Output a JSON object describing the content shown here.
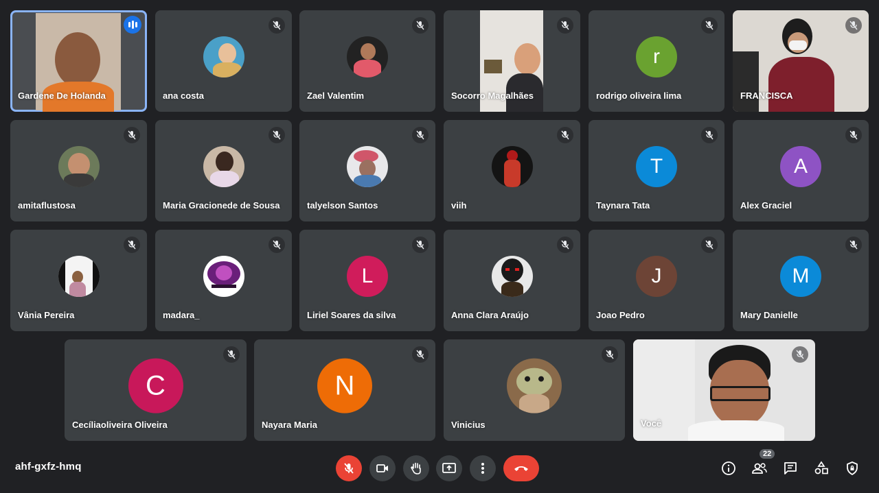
{
  "meeting": {
    "code": "ahf-gxfz-hmq",
    "participants_count": "22"
  },
  "participants": [
    {
      "name": "Gardene De Holanda",
      "kind": "video",
      "speaking": true
    },
    {
      "name": "ana costa",
      "kind": "photo"
    },
    {
      "name": "Zael Valentim",
      "kind": "photo"
    },
    {
      "name": "Socorro Magalhães",
      "kind": "video"
    },
    {
      "name": "rodrigo oliveira lima",
      "kind": "initial",
      "initial": "r",
      "color": "#6aa230"
    },
    {
      "name": "FRANCISCA",
      "kind": "video"
    },
    {
      "name": "amitaflustosa",
      "kind": "photo"
    },
    {
      "name": "Maria Gracionede de Sousa",
      "kind": "photo"
    },
    {
      "name": "talyelson Santos",
      "kind": "photo"
    },
    {
      "name": "viih",
      "kind": "photo"
    },
    {
      "name": "Taynara Tata",
      "kind": "initial",
      "initial": "T",
      "color": "#0b8ad8"
    },
    {
      "name": "Alex Graciel",
      "kind": "initial",
      "initial": "A",
      "color": "#8e53c4"
    },
    {
      "name": "Vânia Pereira",
      "kind": "photo"
    },
    {
      "name": "madara_",
      "kind": "photo"
    },
    {
      "name": "Liriel Soares da silva",
      "kind": "initial",
      "initial": "L",
      "color": "#d01c5b"
    },
    {
      "name": "Anna Clara Araújo",
      "kind": "photo"
    },
    {
      "name": "Joao Pedro",
      "kind": "initial",
      "initial": "J",
      "color": "#6d4436"
    },
    {
      "name": "Mary Danielle",
      "kind": "initial",
      "initial": "M",
      "color": "#0b8ad8"
    },
    {
      "name": "Cecíliaoliveira Oliveira",
      "kind": "initial",
      "initial": "C",
      "color": "#c8185a"
    },
    {
      "name": "Nayara Maria",
      "kind": "initial",
      "initial": "N",
      "color": "#ee6c06"
    },
    {
      "name": "Vinicius",
      "kind": "photo"
    },
    {
      "name": "Você",
      "kind": "video"
    }
  ],
  "colors": {
    "background": "#202124",
    "tile": "#3c4043",
    "danger": "#ea4335",
    "active_border": "#8ab4f8"
  },
  "controls": [
    "mic-off-icon",
    "camera-icon",
    "raise-hand-icon",
    "present-icon",
    "more-icon",
    "end-call-icon"
  ],
  "right_controls": [
    "info-icon",
    "people-icon",
    "chat-icon",
    "activities-icon",
    "host-controls-icon"
  ]
}
